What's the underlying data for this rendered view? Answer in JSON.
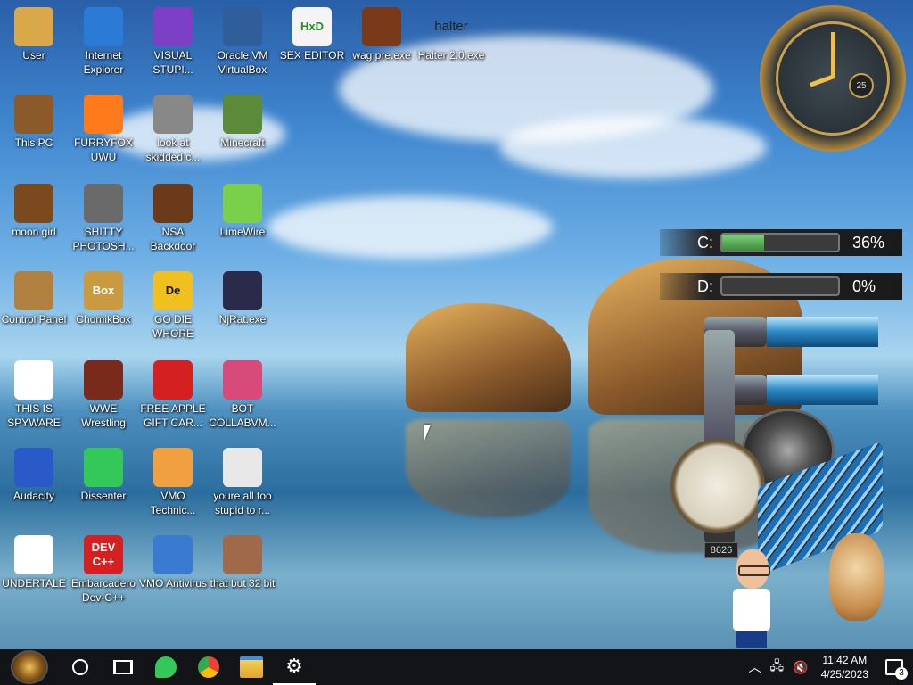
{
  "desktop": {
    "icons": [
      {
        "label": "User",
        "icon": "user-folder-icon"
      },
      {
        "label": "Internet Explorer",
        "icon": "internet-explorer-icon"
      },
      {
        "label": "VISUAL STUPI...",
        "icon": "visual-studio-icon"
      },
      {
        "label": "Oracle VM VirtualBox",
        "icon": "virtualbox-icon"
      },
      {
        "label": "SEX EDITOR",
        "icon": "hex-editor-icon",
        "glyph": "HxD"
      },
      {
        "label": "wag pre.exe",
        "icon": "wooden-box-icon"
      },
      {
        "label": "Halter 2.0.exe",
        "icon": "halter-text-icon",
        "glyph": "halter"
      },
      {
        "label": "This PC",
        "icon": "steampunk-computer-icon"
      },
      {
        "label": "FURRYFOX UWU",
        "icon": "firefox-icon"
      },
      {
        "label": "look at skidded c...",
        "icon": "stacked-windows-icon"
      },
      {
        "label": "Minecraft",
        "icon": "minecraft-block-icon"
      },
      {
        "label": "moon girl",
        "icon": "wooden-cabinet-icon"
      },
      {
        "label": "SHITTY PHOTOSH...",
        "icon": "gimp-icon"
      },
      {
        "label": "NSA Backdoor",
        "icon": "wooden-clock-icon"
      },
      {
        "label": "LimeWire",
        "icon": "limewire-icon"
      },
      {
        "label": "Control Panel",
        "icon": "lightbulb-gear-icon"
      },
      {
        "label": "ChomikBox",
        "icon": "hamster-box-icon",
        "glyph": "Box"
      },
      {
        "label": "GO DIE WHORE",
        "icon": "de-letters-icon",
        "glyph": "De"
      },
      {
        "label": "NjRat.exe",
        "icon": "skull-icon"
      },
      {
        "label": "THIS IS SPYWARE",
        "icon": "chrome-icon"
      },
      {
        "label": "WWE Wrestling",
        "icon": "retro-tv-icon"
      },
      {
        "label": "FREE APPLE GIFT CAR...",
        "icon": "apple-icon"
      },
      {
        "label": "BOT COLLABVM...",
        "icon": "monitor-icon"
      },
      {
        "label": "Audacity",
        "icon": "audacity-headphones-icon"
      },
      {
        "label": "Dissenter",
        "icon": "dissenter-icon"
      },
      {
        "label": "VMO Technic...",
        "icon": "technician-icon"
      },
      {
        "label": "youre all too stupid to r...",
        "icon": "portrait-sketch-icon"
      },
      {
        "label": "UNDERTALE",
        "icon": "unity-icon"
      },
      {
        "label": "Embarcadero Dev-C++",
        "icon": "devcpp-icon",
        "glyph": "DEV C++"
      },
      {
        "label": "VMO Antivirus",
        "icon": "shield-icon"
      },
      {
        "label": "that but 32 bit",
        "icon": "portrait-painting-icon"
      }
    ]
  },
  "widgets": {
    "clock": {
      "day": "25"
    },
    "drives": [
      {
        "label": "C:",
        "percent": "36%",
        "fill": 0.36
      },
      {
        "label": "D:",
        "percent": "0%",
        "fill": 0.0
      }
    ],
    "gauge_counter": "8626"
  },
  "taskbar": {
    "items": [
      {
        "icon": "steampunk-start-icon"
      },
      {
        "icon": "search-circle-icon"
      },
      {
        "icon": "task-view-icon"
      },
      {
        "icon": "dissenter-taskbar-icon"
      },
      {
        "icon": "chrome-taskbar-icon"
      },
      {
        "icon": "file-explorer-icon"
      },
      {
        "icon": "settings-gear-icon"
      }
    ],
    "tray": {
      "time": "11:42 AM",
      "date": "4/25/2023",
      "notifications": "3"
    }
  },
  "colors": {
    "taskbar": "#121418",
    "accent_green": "#34c759"
  }
}
